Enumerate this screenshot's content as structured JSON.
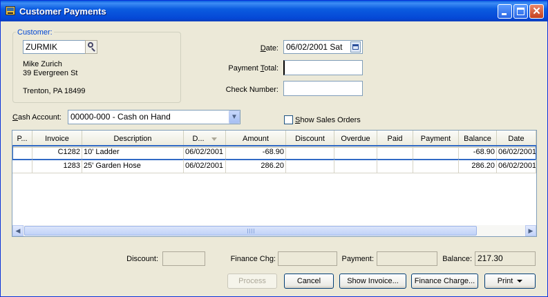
{
  "window": {
    "title": "Customer Payments",
    "close_glyph": "✕"
  },
  "customer": {
    "group_label": "Customer:",
    "code": "ZURMIK",
    "name": "Mike Zurich",
    "address1": "39 Evergreen St",
    "city_line": "Trenton, PA 18499"
  },
  "payment": {
    "date_label": "Date:",
    "date_value": "06/02/2001 Sat",
    "total_label": "Payment Total:",
    "total_value": "",
    "check_label": "Check Number:",
    "check_value": ""
  },
  "cash_account": {
    "label": "Cash Account:",
    "value": "00000-000 - Cash on Hand",
    "caret": "▼"
  },
  "show_sales_orders": {
    "label": "Show Sales Orders",
    "checked": false
  },
  "grid": {
    "columns": [
      "P...",
      "Invoice",
      "Description",
      "D...",
      "Amount",
      "Discount",
      "Overdue",
      "Paid",
      "Payment",
      "Balance",
      "Date"
    ],
    "rows": [
      {
        "p": "",
        "invoice": "C1282",
        "description": "10' Ladder",
        "d": "06/02/2001",
        "amount": "-68.90",
        "discount": "",
        "overdue": "",
        "paid": "",
        "payment": "",
        "balance": "-68.90",
        "date": "06/02/2001"
      },
      {
        "p": "",
        "invoice": "1283",
        "description": "25' Garden Hose",
        "d": "06/02/2001",
        "amount": "286.20",
        "discount": "",
        "overdue": "",
        "paid": "",
        "payment": "",
        "balance": "286.20",
        "date": "06/02/2001"
      }
    ],
    "scroll_left": "◀",
    "scroll_right": "▶"
  },
  "totals": {
    "discount_label": "Discount:",
    "discount_value": "",
    "finance_label": "Finance Chg:",
    "finance_value": "",
    "payment_label": "Payment:",
    "payment_value": "",
    "balance_label": "Balance:",
    "balance_value": "217.30"
  },
  "buttons": {
    "process": "Process",
    "cancel": "Cancel",
    "show_invoice": "Show Invoice...",
    "finance_charge": "Finance Charge...",
    "print": "Print"
  },
  "colors": {
    "title_bar": "#0a5ddf",
    "group_label": "#0046d5",
    "selection": "#316ac5",
    "window_bg": "#ece9d8"
  }
}
